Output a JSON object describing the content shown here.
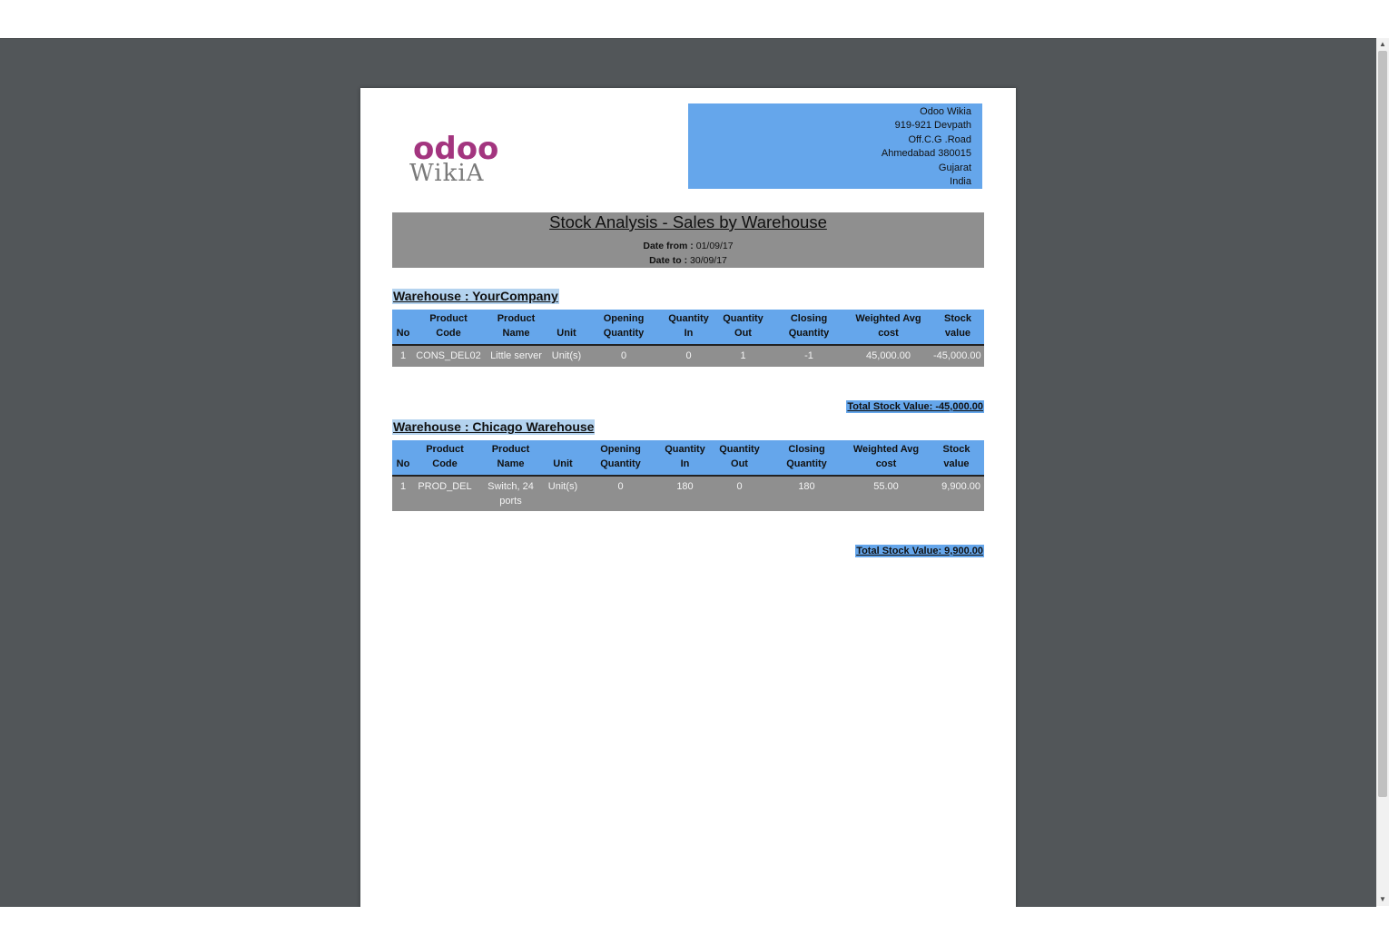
{
  "company": {
    "logo_text_top": "odoo",
    "logo_text_bottom": "WikiA",
    "name": "Odoo Wikia",
    "address_line1": "919-921 Devpath",
    "address_line2": "Off.C.G .Road",
    "address_line3": "Ahmedabad 380015",
    "state": "Gujarat",
    "country": "India"
  },
  "report": {
    "title": "Stock Analysis - Sales by Warehouse",
    "date_from_label": "Date from :",
    "date_from": "01/09/17",
    "date_to_label": "Date to :",
    "date_to": "30/09/17"
  },
  "columns": {
    "no": "No",
    "code_1": "Product",
    "code_2": "Code",
    "name_1": "Product",
    "name_2": "Name",
    "unit": "Unit",
    "open_1": "Opening",
    "open_2": "Quantity",
    "qin_1": "Quantity",
    "qin_2": "In",
    "qout_1": "Quantity",
    "qout_2": "Out",
    "close_1": "Closing",
    "close_2": "Quantity",
    "avg_1": "Weighted Avg",
    "avg_2": "cost",
    "value_1": "Stock",
    "value_2": "value"
  },
  "warehouses": [
    {
      "heading": "Warehouse : YourCompany",
      "rows": [
        {
          "no": "1",
          "code": "CONS_DEL02",
          "name": "Little server",
          "unit": "Unit(s)",
          "opening": "0",
          "qty_in": "0",
          "qty_out": "1",
          "closing": "-1",
          "avg_cost": "45,000.00",
          "value": "-45,000.00"
        }
      ],
      "total": "Total Stock Value: -45,000.00"
    },
    {
      "heading": "Warehouse : Chicago Warehouse",
      "rows": [
        {
          "no": "1",
          "code": "PROD_DEL",
          "name": "Switch, 24 ports",
          "unit": "Unit(s)",
          "opening": "0",
          "qty_in": "180",
          "qty_out": "0",
          "closing": "180",
          "avg_cost": "55.00",
          "value": "9,900.00"
        }
      ],
      "total": "Total Stock Value: 9,900.00"
    }
  ],
  "colors": {
    "viewer_bg": "#525659",
    "accent_blue": "#65a6eb",
    "header_gray": "#8f8f8f",
    "logo_magenta": "#a3357f",
    "logo_gray": "#7a7a7a"
  }
}
